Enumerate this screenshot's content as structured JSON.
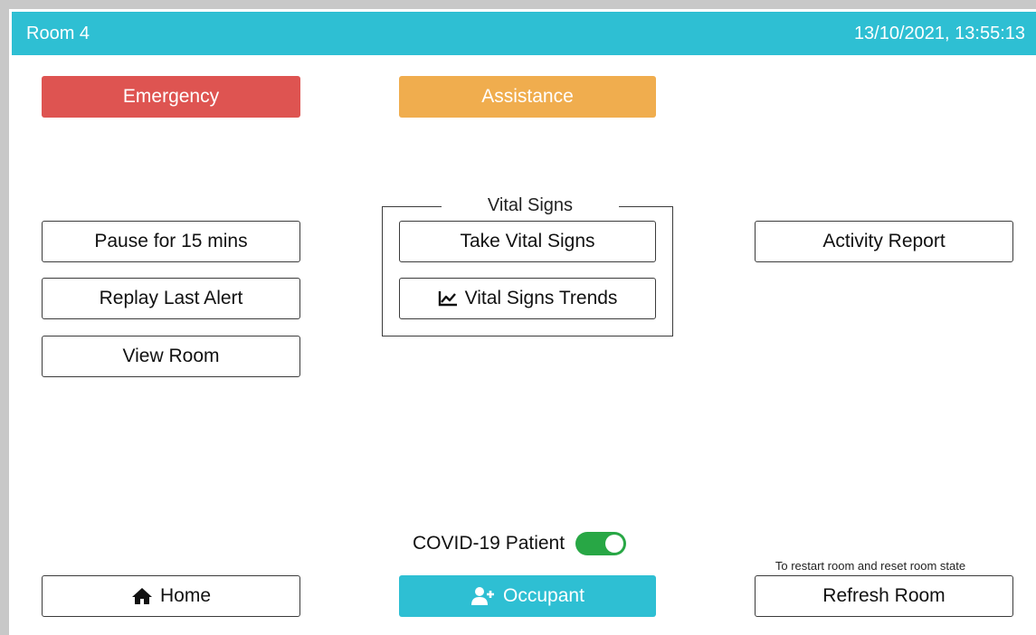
{
  "header": {
    "title": "Room 4",
    "datetime": "13/10/2021, 13:55:13"
  },
  "alerts": {
    "emergency_label": "Emergency",
    "assistance_label": "Assistance"
  },
  "left_actions": {
    "pause_label": "Pause for 15 mins",
    "replay_label": "Replay Last Alert",
    "view_label": "View Room"
  },
  "vital_signs": {
    "group_title": "Vital Signs",
    "take_label": "Take Vital Signs",
    "trends_label": "Vital Signs Trends",
    "trends_icon": "line-chart-icon"
  },
  "right_actions": {
    "activity_label": "Activity Report"
  },
  "covid": {
    "label": "COVID-19 Patient",
    "enabled": true
  },
  "footer": {
    "home_label": "Home",
    "home_icon": "home-icon",
    "occupant_label": "Occupant",
    "occupant_icon": "add-user-icon",
    "refresh_hint": "To restart room and reset room state",
    "refresh_label": "Refresh Room"
  },
  "colors": {
    "header": "#2ebfd3",
    "emergency": "#de5451",
    "assistance": "#f0ad4e",
    "occupant": "#2ebfd3",
    "toggle_on": "#28a745"
  }
}
